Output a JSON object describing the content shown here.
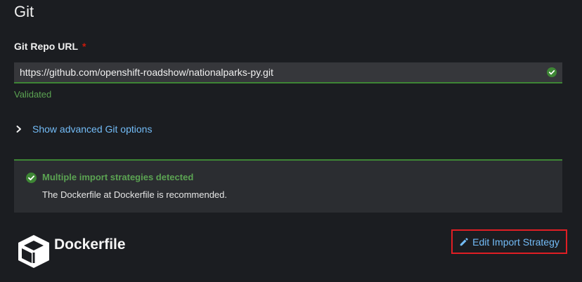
{
  "section": {
    "title": "Git"
  },
  "git_repo": {
    "label": "Git Repo URL",
    "required_marker": "*",
    "value": "https://github.com/openshift-roadshow/nationalparks-py.git",
    "helper": "Validated",
    "status_icon": "check-circle-icon"
  },
  "advanced": {
    "label": "Show advanced Git options",
    "icon": "chevron-right-icon"
  },
  "alert": {
    "icon": "check-circle-icon",
    "title": "Multiple import strategies detected",
    "body": "The Dockerfile at Dockerfile is recommended."
  },
  "strategy": {
    "icon": "box-icon",
    "name": "Dockerfile",
    "edit_icon": "pencil-icon",
    "edit_label": "Edit Import Strategy"
  },
  "colors": {
    "background": "#1b1d21",
    "success": "#3e8635",
    "success_text": "#5ba352",
    "link": "#73bcf7",
    "highlight_border": "#e01e24",
    "required": "#c9190b"
  }
}
